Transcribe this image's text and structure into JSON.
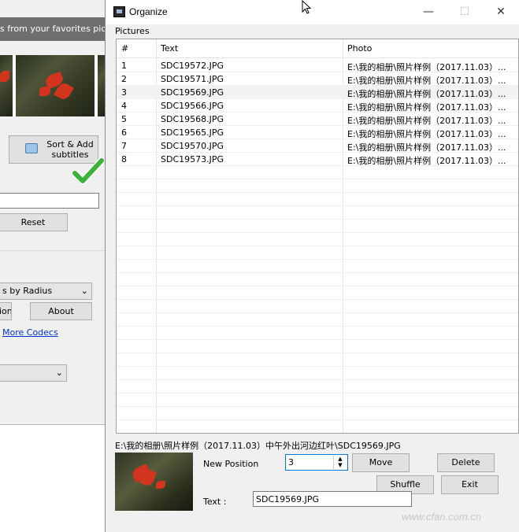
{
  "background_window": {
    "banner_text": "s from your favorites pictures",
    "sort_add_button": "Sort & Add\nsubtitles",
    "reset_button": "Reset",
    "radius_select": "s by Radius",
    "partial_button": "ion",
    "about_button": "About",
    "codecs_link": "More Codecs"
  },
  "window": {
    "title": "Organize",
    "minimize_glyph": "—",
    "maximize_glyph": "☐",
    "close_glyph": "✕"
  },
  "pictures": {
    "group_label": "Pictures",
    "columns": [
      "#",
      "Text",
      "Photo"
    ],
    "selected_index": 2,
    "rows": [
      {
        "num": "1",
        "text": "SDC19572.JPG",
        "photo": "E:\\我的相册\\照片样例（2017.11.03）..."
      },
      {
        "num": "2",
        "text": "SDC19571.JPG",
        "photo": "E:\\我的相册\\照片样例（2017.11.03）..."
      },
      {
        "num": "3",
        "text": "SDC19569.JPG",
        "photo": "E:\\我的相册\\照片样例（2017.11.03）..."
      },
      {
        "num": "4",
        "text": "SDC19566.JPG",
        "photo": "E:\\我的相册\\照片样例（2017.11.03）..."
      },
      {
        "num": "5",
        "text": "SDC19568.JPG",
        "photo": "E:\\我的相册\\照片样例（2017.11.03）..."
      },
      {
        "num": "6",
        "text": "SDC19565.JPG",
        "photo": "E:\\我的相册\\照片样例（2017.11.03）..."
      },
      {
        "num": "7",
        "text": "SDC19570.JPG",
        "photo": "E:\\我的相册\\照片样例（2017.11.03）..."
      },
      {
        "num": "8",
        "text": "SDC19573.JPG",
        "photo": "E:\\我的相册\\照片样例（2017.11.03）..."
      }
    ]
  },
  "details": {
    "path": "E:\\我的相册\\照片样例（2017.11.03）中午外出河边红叶\\SDC19569.JPG",
    "new_position_label": "New Position",
    "new_position_value": "3",
    "move_button": "Move",
    "delete_button": "Delete",
    "shuffle_button": "Shuffle",
    "exit_button": "Exit",
    "text_label": "Text :",
    "text_value": "SDC19569.JPG"
  },
  "watermark": "www.cfan.com.cn"
}
